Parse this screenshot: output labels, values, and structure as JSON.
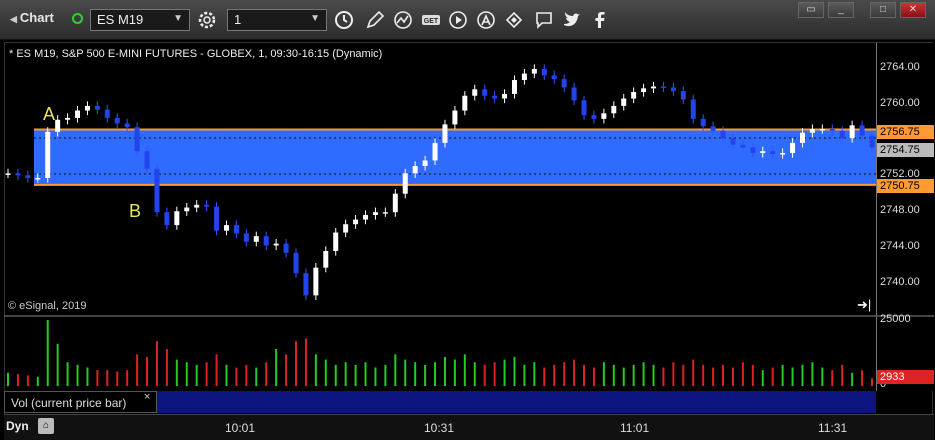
{
  "toolbar": {
    "title": "Chart",
    "symbol": "ES M19",
    "interval": "1",
    "icons": [
      "settings-icon",
      "clock-icon",
      "pencil-icon",
      "study-icon",
      "get-icon",
      "play-icon",
      "alert-icon",
      "link-icon",
      "comment-icon",
      "twitter-icon",
      "facebook-icon"
    ],
    "window_buttons": [
      "minimize",
      "maximize",
      "close"
    ]
  },
  "chart": {
    "title": "* ES M19, S&P 500 E-MINI FUTURES - GLOBEX, 1, 09:30-16:15 (Dynamic)",
    "copyright": "© eSignal, 2019",
    "marker_a": "A",
    "marker_b": "B",
    "price_ticks": [
      "2764.00",
      "2760.00",
      "2756.00",
      "2752.00",
      "2748.00",
      "2744.00",
      "2740.00"
    ],
    "upper_level": "2756.75",
    "lower_level": "2750.75",
    "current_price": "2754.75",
    "vol_ticks": [
      "25000",
      "0"
    ],
    "current_volume": "2933",
    "time_ticks": [
      "10:01",
      "10:31",
      "11:01",
      "11:31"
    ],
    "colors": {
      "zone": "#2f6bff",
      "level_line": "#ff9933",
      "up_volume": "#22cc22",
      "down_volume": "#dd2222",
      "candle_up": "#ffffff",
      "candle_down": "#3355ff"
    }
  },
  "volume_legend": "Vol (current price bar)",
  "status": {
    "mode": "Dyn"
  },
  "chart_data": {
    "type": "candlestick",
    "price_range": [
      2737,
      2766
    ],
    "zone": [
      2750.75,
      2756.75
    ],
    "closes": [
      2752.0,
      2751.8,
      2751.5,
      2751.5,
      2756.5,
      2757.8,
      2758.0,
      2758.8,
      2759.3,
      2758.9,
      2758.0,
      2757.4,
      2757.0,
      2754.4,
      2752.5,
      2747.8,
      2746.4,
      2747.9,
      2748.3,
      2748.6,
      2748.4,
      2745.8,
      2746.4,
      2745.5,
      2744.6,
      2745.2,
      2744.2,
      2744.4,
      2743.4,
      2741.2,
      2738.8,
      2741.8,
      2743.6,
      2745.6,
      2746.5,
      2747.0,
      2747.5,
      2747.8,
      2747.8,
      2749.8,
      2752.0,
      2752.8,
      2753.4,
      2755.3,
      2757.3,
      2758.8,
      2760.4,
      2761.1,
      2760.4,
      2760.1,
      2760.6,
      2762.1,
      2762.8,
      2763.3,
      2762.6,
      2762.2,
      2761.3,
      2759.9,
      2758.3,
      2757.9,
      2758.5,
      2759.3,
      2760.1,
      2760.8,
      2761.2,
      2761.4,
      2761.3,
      2760.9,
      2760.0,
      2757.9,
      2757.1,
      2756.6,
      2755.8,
      2755.1,
      2754.8,
      2754.2,
      2754.4,
      2754.1,
      2754.2,
      2755.3,
      2756.4,
      2756.8,
      2756.8,
      2756.6,
      2755.8,
      2757.2,
      2756.1,
      2754.8
    ],
    "volumes": [
      5000,
      4500,
      4000,
      3500,
      25000,
      16000,
      9000,
      8000,
      7000,
      6000,
      6000,
      5500,
      6000,
      12000,
      11000,
      17000,
      14000,
      10000,
      9000,
      8000,
      9000,
      12000,
      8000,
      7000,
      8000,
      7000,
      9000,
      14000,
      12000,
      17000,
      18000,
      12000,
      10000,
      8000,
      9000,
      8000,
      9000,
      7000,
      8000,
      12000,
      10000,
      9000,
      8000,
      9000,
      11000,
      10000,
      12000,
      9000,
      8000,
      9000,
      10000,
      11000,
      8000,
      9000,
      7000,
      8000,
      9000,
      10000,
      8000,
      7000,
      9000,
      8000,
      7000,
      8000,
      9000,
      8000,
      7000,
      9000,
      8000,
      10000,
      8000,
      7000,
      8000,
      7000,
      9000,
      8000,
      6000,
      7000,
      8000,
      7000,
      8000,
      9000,
      7000,
      6000,
      8000,
      5000,
      6000,
      2933
    ]
  }
}
